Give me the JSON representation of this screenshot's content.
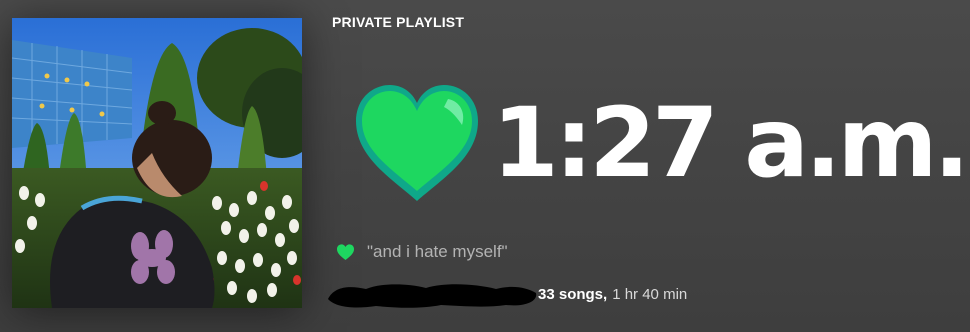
{
  "playlist": {
    "type_label": "PRIVATE PLAYLIST",
    "title": "1:27 a.m.",
    "title_icon": "green-heart-icon",
    "description": "\"and i hate myself\"",
    "description_icon": "green-heart-icon",
    "owner_redacted": true,
    "song_count": "33 songs,",
    "duration": "1 hr 40 min"
  },
  "colors": {
    "background": "#454545",
    "heart_green": "#1ed760",
    "heart_dark": "#0fa889",
    "text_secondary": "#b3b3b3"
  }
}
